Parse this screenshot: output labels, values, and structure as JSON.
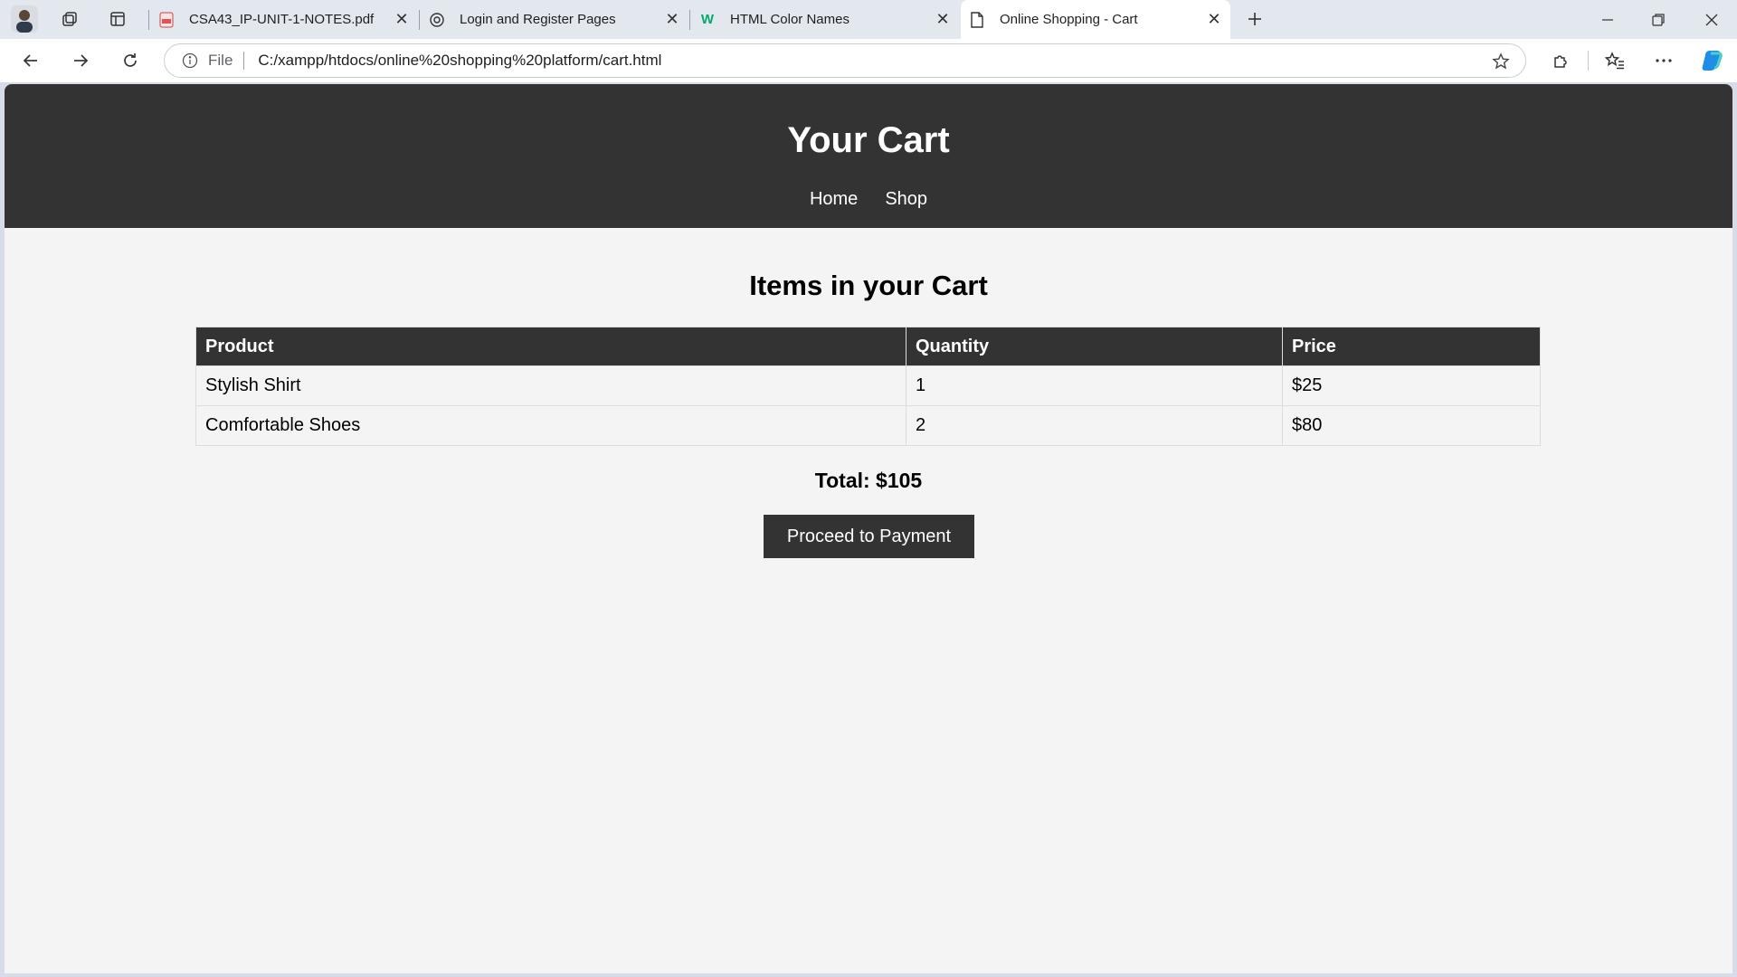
{
  "browser": {
    "tabs": [
      {
        "title": "CSA43_IP-UNIT-1-NOTES.pdf",
        "icon": "pdf-icon"
      },
      {
        "title": "Login and Register Pages",
        "icon": "chatgpt-icon"
      },
      {
        "title": "HTML Color Names",
        "icon": "w3schools-icon"
      },
      {
        "title": "Online Shopping - Cart",
        "icon": "page-icon",
        "active": true
      }
    ],
    "address_prefix": "File",
    "url": "C:/xampp/htdocs/online%20shopping%20platform/cart.html"
  },
  "page": {
    "header_title": "Your Cart",
    "nav": [
      "Home",
      "Shop"
    ],
    "section_heading": "Items in your Cart",
    "table": {
      "headers": [
        "Product",
        "Quantity",
        "Price"
      ],
      "rows": [
        [
          "Stylish Shirt",
          "1",
          "$25"
        ],
        [
          "Comfortable Shoes",
          "2",
          "$80"
        ]
      ]
    },
    "total": "Total: $105",
    "button_label": "Proceed to Payment"
  },
  "colors": {
    "header_bg": "#333333",
    "page_bg": "#f4f4f4",
    "button_bg": "#333333"
  }
}
